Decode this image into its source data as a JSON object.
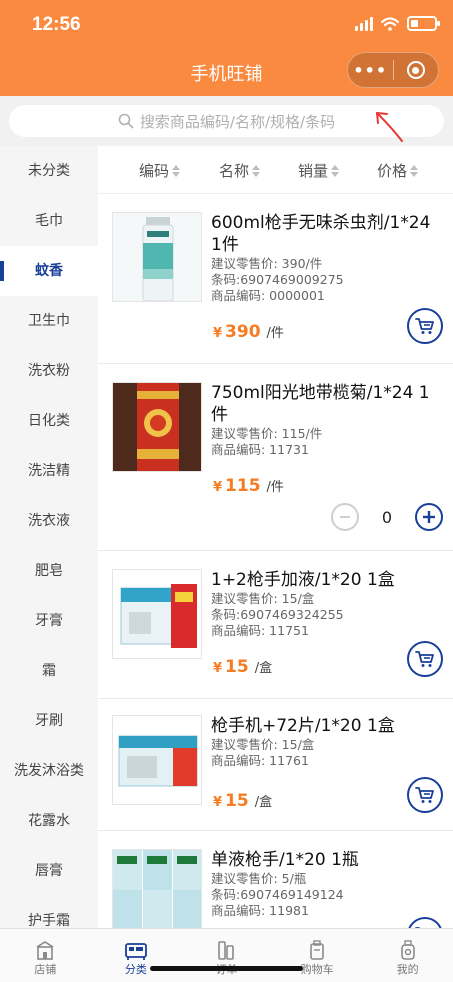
{
  "status_bar": {
    "time": "12:56"
  },
  "header": {
    "title": "手机旺铺",
    "more_label": "•••"
  },
  "search": {
    "placeholder": "搜索商品编码/名称/规格/条码"
  },
  "sidebar": {
    "items": [
      {
        "label": "未分类",
        "active": false
      },
      {
        "label": "毛巾",
        "active": false
      },
      {
        "label": "蚊香",
        "active": true
      },
      {
        "label": "卫生巾",
        "active": false
      },
      {
        "label": "洗衣粉",
        "active": false
      },
      {
        "label": "日化类",
        "active": false
      },
      {
        "label": "洗洁精",
        "active": false
      },
      {
        "label": "洗衣液",
        "active": false
      },
      {
        "label": "肥皂",
        "active": false
      },
      {
        "label": "牙膏",
        "active": false
      },
      {
        "label": "霜",
        "active": false
      },
      {
        "label": "牙刷",
        "active": false
      },
      {
        "label": "洗发沐浴类",
        "active": false
      },
      {
        "label": "花露水",
        "active": false
      },
      {
        "label": "唇膏",
        "active": false
      },
      {
        "label": "护手霜",
        "active": false
      }
    ]
  },
  "sort_bar": {
    "code": "编码",
    "name": "名称",
    "sales": "销量",
    "price": "价格"
  },
  "products": [
    {
      "name_line1": "600ml枪手无味杀虫剂/1*24",
      "name_line2": "1件",
      "retail": "建议零售价: 390/件",
      "barcode": "条码:6907469009275",
      "code": "商品编码: 0000001",
      "currency": "¥",
      "price": "390",
      "unit": "/件"
    },
    {
      "name_line1": "750ml阳光地带榄菊/1*24 1",
      "name_line2": "件",
      "retail": "建议零售价: 115/件",
      "code": "商品编码: 11731",
      "currency": "¥",
      "price": "115",
      "unit": "/件",
      "quantity": "0"
    },
    {
      "name_line1": "1+2枪手加液/1*20 1盒",
      "retail": "建议零售价: 15/盒",
      "barcode": "条码:6907469324255",
      "code": "商品编码: 11751",
      "currency": "¥",
      "price": "15",
      "unit": "/盒"
    },
    {
      "name_line1": "枪手机+72片/1*20 1盒",
      "retail": "建议零售价: 15/盒",
      "code": "商品编码: 11761",
      "currency": "¥",
      "price": "15",
      "unit": "/盒"
    },
    {
      "name_line1": "单液枪手/1*20 1瓶",
      "retail": "建议零售价: 5/瓶",
      "barcode": "条码:6907469149124",
      "code": "商品编码: 11981"
    }
  ],
  "tabbar": {
    "items": [
      {
        "label": "店铺",
        "icon": "shop-icon",
        "active": false
      },
      {
        "label": "分类",
        "icon": "category-icon",
        "active": true
      },
      {
        "label": "订单",
        "icon": "order-icon",
        "active": false
      },
      {
        "label": "购物车",
        "icon": "cart-icon",
        "active": false
      },
      {
        "label": "我的",
        "icon": "profile-icon",
        "active": false
      }
    ]
  },
  "colors": {
    "header": "#fb8a41",
    "accent": "#1a3f99",
    "price": "#f57c22",
    "annotation": "#e53935"
  }
}
